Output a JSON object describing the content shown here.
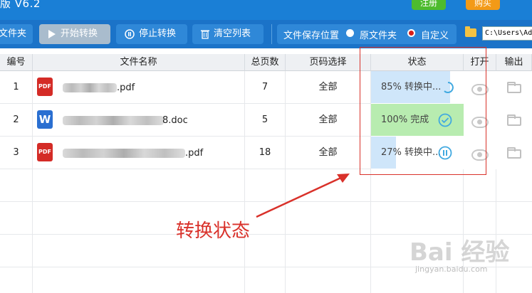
{
  "title_bar": {
    "app_title": "版 V6.2",
    "register_label": "注册",
    "buy_label": "购买"
  },
  "toolbar": {
    "add_folder_label": "文件夹",
    "start_label": "开始转换",
    "stop_label": "停止转换",
    "clear_label": "清空列表",
    "save_location_label": "文件保存位置",
    "radio_source": "原文件夹",
    "radio_custom": "自定义",
    "selected_option": "自定义",
    "path_value": "C:\\Users\\Ad"
  },
  "table": {
    "headers": [
      "编号",
      "文件名称",
      "总页数",
      "页码选择",
      "状态",
      "打开",
      "输出"
    ],
    "rows": [
      {
        "no": "1",
        "icon": "pdf-icon",
        "name_suffix": ".pdf",
        "pages": "7",
        "range": "全部",
        "progress": 0.85,
        "status": "85% 转换中...",
        "status_icon": "progress-ring-icon"
      },
      {
        "no": "2",
        "icon": "word-icon",
        "name_suffix": "8.doc",
        "pages": "5",
        "range": "全部",
        "progress": 1.0,
        "status": "100% 完成",
        "status_icon": "check-circle-icon"
      },
      {
        "no": "3",
        "icon": "pdf-icon",
        "name_suffix": ".pdf",
        "pages": "18",
        "range": "全部",
        "progress": 0.27,
        "status": "27% 转换中...",
        "status_icon": "pause-circle-icon"
      }
    ]
  },
  "icons": {
    "pdf_label": "PDF",
    "word_label": "W"
  },
  "annotation": {
    "text": "转换状态"
  },
  "watermark": {
    "text": "Bai 经验",
    "url": "jingyan.baidu.com"
  },
  "colors": {
    "progress_blue": "#cfe6fa",
    "done_green": "#b8ecb0",
    "annot_red": "#d9312a"
  }
}
